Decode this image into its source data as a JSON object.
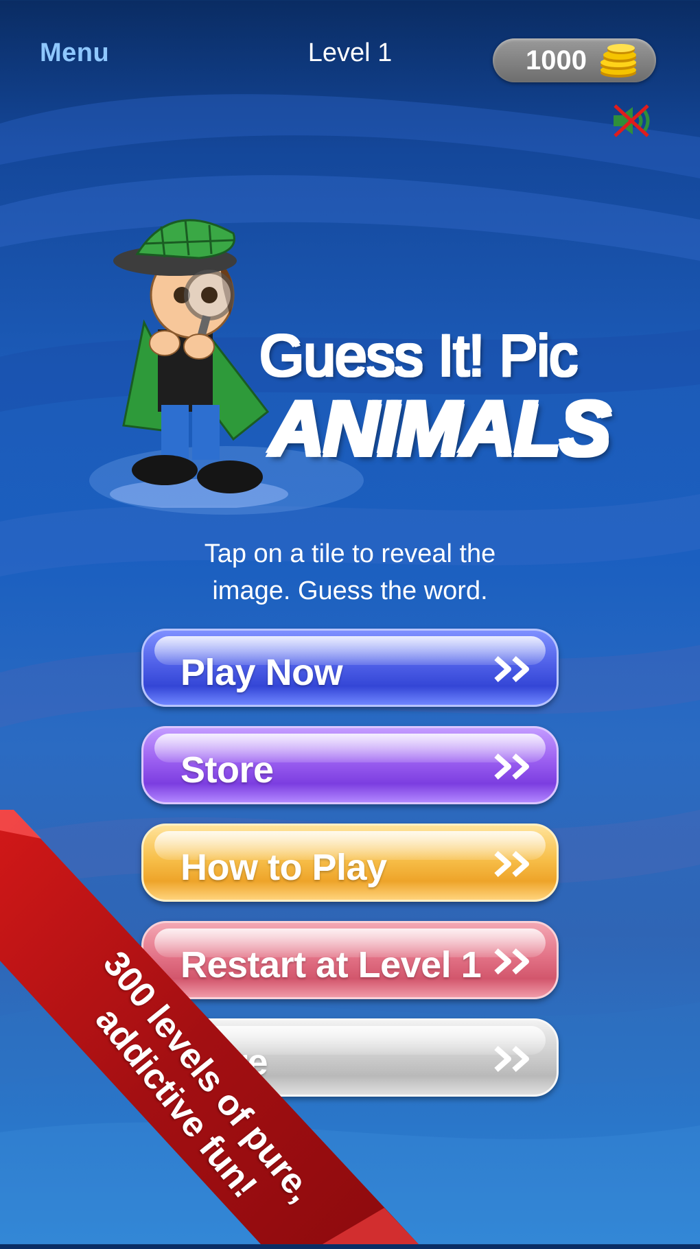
{
  "header": {
    "menu_label": "Menu",
    "level_label": "Level 1",
    "coins": "1000"
  },
  "sound": {
    "muted": true,
    "icon": "speaker-muted-icon"
  },
  "logo": {
    "line1": "Guess It! Pic",
    "line2": "ANIMALS"
  },
  "instructions": {
    "line1": "Tap on a tile to reveal the",
    "line2": "image. Guess the word."
  },
  "buttons": [
    {
      "label": "Play Now",
      "color": "#4f60e8"
    },
    {
      "label": "Store",
      "color": "#9a5ef0"
    },
    {
      "label": "How to Play",
      "color": "#f7bf4a"
    },
    {
      "label": "Restart at Level 1",
      "color": "#e37387"
    },
    {
      "label": "More",
      "color": "#cfcfcf"
    }
  ],
  "ribbon": {
    "line1": "300 levels of pure,",
    "line2": "addictive fun!"
  }
}
